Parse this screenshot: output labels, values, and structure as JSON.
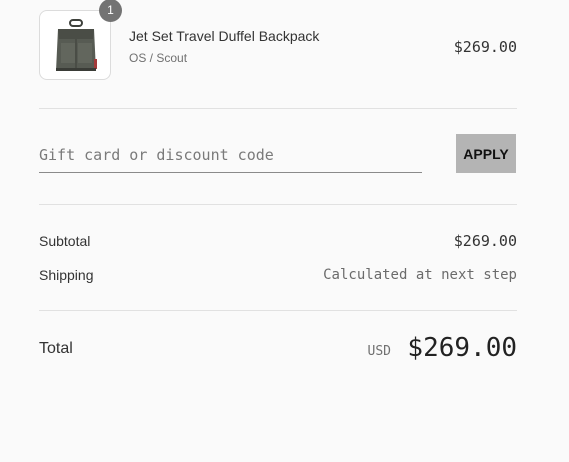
{
  "line_item": {
    "quantity": "1",
    "name": "Jet Set Travel Duffel Backpack",
    "variant": "OS / Scout",
    "price": "$269.00",
    "image_icon": "backpack-icon"
  },
  "discount": {
    "placeholder": "Gift card or discount code",
    "value": "",
    "apply_label": "APPLY"
  },
  "summary": {
    "subtotal_label": "Subtotal",
    "subtotal_value": "$269.00",
    "shipping_label": "Shipping",
    "shipping_value": "Calculated at next step"
  },
  "total": {
    "label": "Total",
    "currency": "USD",
    "value": "$269.00"
  },
  "colors": {
    "background": "#fafafa",
    "apply_button": "#b4b4b4",
    "badge": "#737373",
    "divider": "#e1e1e1"
  }
}
